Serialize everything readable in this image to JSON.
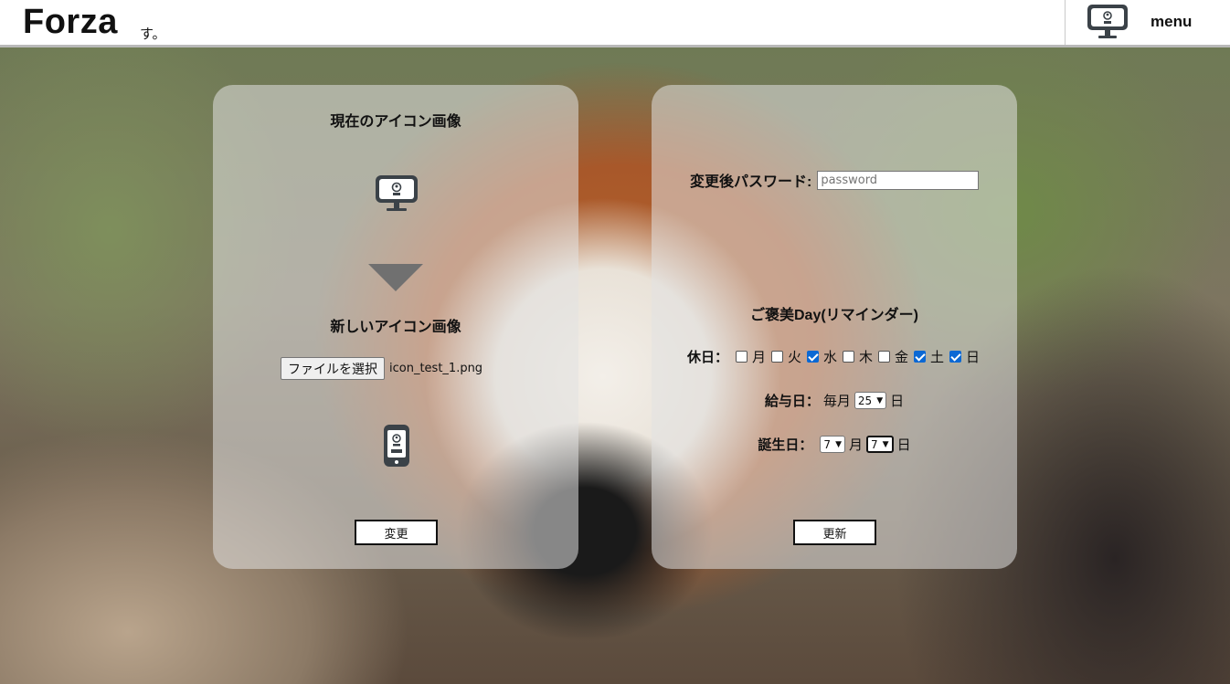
{
  "header": {
    "logo": "Forza",
    "logo_sub": "す。",
    "menu_label": "menu"
  },
  "left_card": {
    "current_icon_title": "現在のアイコン画像",
    "new_icon_title": "新しいアイコン画像",
    "file_button": "ファイルを選択",
    "file_name": "icon_test_1.png",
    "submit_label": "変更"
  },
  "right_card": {
    "password_label": "変更後パスワード:",
    "password_placeholder": "password",
    "reminder_title": "ご褒美Day(リマインダー)",
    "holiday_label": "休日：",
    "days": [
      {
        "label": "月",
        "checked": false
      },
      {
        "label": "火",
        "checked": false
      },
      {
        "label": "水",
        "checked": true
      },
      {
        "label": "木",
        "checked": false
      },
      {
        "label": "金",
        "checked": false
      },
      {
        "label": "土",
        "checked": true
      },
      {
        "label": "日",
        "checked": true
      }
    ],
    "payday_label": "給与日：",
    "payday_prefix": "毎月",
    "payday_value": "25",
    "payday_suffix": "日",
    "birthday_label": "誕生日：",
    "birthday_month": "7",
    "month_unit": "月",
    "birthday_day": "7",
    "day_unit": "日",
    "submit_label": "更新"
  },
  "colors": {
    "checkbox_checked": "#0b68d4",
    "card_bg": "rgba(225,225,225,0.55)"
  }
}
